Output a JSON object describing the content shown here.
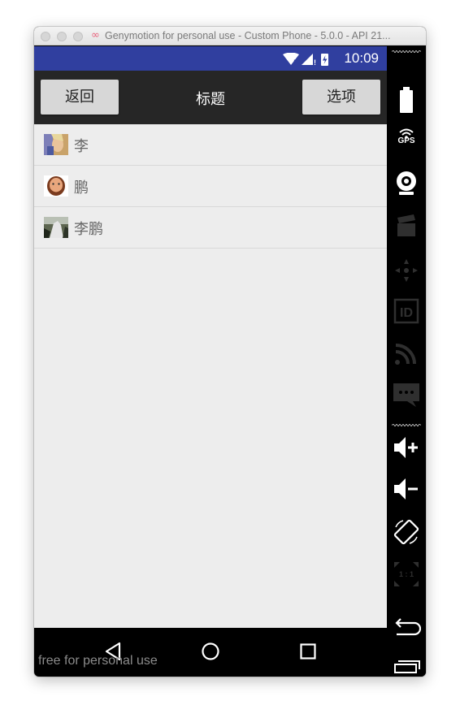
{
  "window": {
    "title": "Genymotion for personal use - Custom Phone - 5.0.0 - API 21..."
  },
  "statusbar": {
    "time": "10:09",
    "background": "#303f9f"
  },
  "appbar": {
    "back_label": "返回",
    "title": "标题",
    "options_label": "选项"
  },
  "list": {
    "items": [
      {
        "label": "李",
        "avatar": "woman-photo"
      },
      {
        "label": "鹏",
        "avatar": "bearded-man-cartoon"
      },
      {
        "label": "李鹏",
        "avatar": "landscape-photo"
      }
    ]
  },
  "navbar": {
    "back_icon": "triangle-back-icon",
    "home_icon": "circle-home-icon",
    "recents_icon": "square-recents-icon"
  },
  "watermark": "free for personal use",
  "sidebar": {
    "icons": [
      "battery-icon",
      "gps-icon",
      "webcam-icon",
      "video-clapper-icon",
      "dpad-icon",
      "id-icon",
      "cast-icon",
      "sms-icon",
      "volume-up-icon",
      "volume-down-icon",
      "rotate-icon",
      "pixel-perfect-icon",
      "back-icon",
      "recent-apps-icon"
    ],
    "gps_label": "GPS",
    "id_label": "ID",
    "pixel_label": "1 : 1"
  }
}
